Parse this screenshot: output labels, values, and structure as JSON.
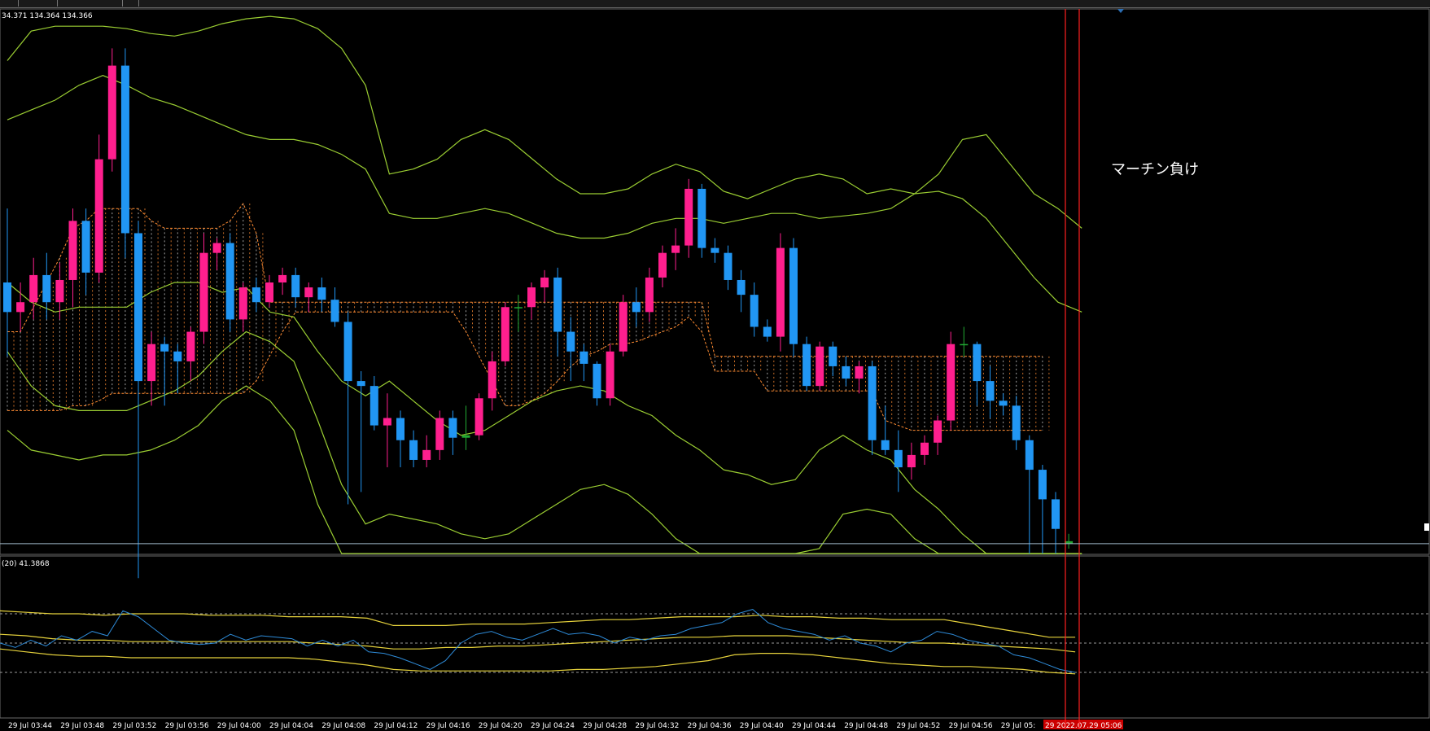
{
  "window": {
    "ohlc_readout": "34.371 134.364 134.366",
    "annotation": "マーチン負け"
  },
  "sub_window": {
    "indicator_label": "(20) 41.3868"
  },
  "colors": {
    "bull": "#ff1f8e",
    "bear": "#2196f3",
    "doji": "#22aa33",
    "band": "#9acd32",
    "cloud": "#ff8c32",
    "cloud_fill": "#d8d8d8",
    "sub_band": "#e6d23c",
    "sub_line": "#2e8bd8",
    "vline": "#ff2020",
    "grid_level": "#9a9a9a",
    "date_badge": "#cc0000"
  },
  "chart_data": {
    "type": "candlestick",
    "title": "",
    "xlabel": "",
    "ylabel": "",
    "ylim": [
      134.22,
      134.44
    ],
    "current_price_line": 134.224,
    "x_tick_labels": [
      "29 Jul 03:44",
      "29 Jul 03:48",
      "29 Jul 03:52",
      "29 Jul 03:56",
      "29 Jul 04:00",
      "29 Jul 04:04",
      "29 Jul 04:08",
      "29 Jul 04:12",
      "29 Jul 04:16",
      "29 Jul 04:20",
      "29 Jul 04:24",
      "29 Jul 04:28",
      "29 Jul 04:32",
      "29 Jul 04:36",
      "29 Jul 04:40",
      "29 Jul 04:44",
      "29 Jul 04:48",
      "29 Jul 04:52",
      "29 Jul 04:56",
      "29 Jul 05:",
      "2022.07.29 05:06"
    ],
    "date_badge_prefix": "29",
    "candles": [
      [
        134.33,
        134.36,
        134.3,
        134.318
      ],
      [
        134.318,
        134.33,
        134.31,
        134.322
      ],
      [
        134.322,
        134.34,
        134.315,
        134.333
      ],
      [
        134.333,
        134.342,
        134.315,
        134.322
      ],
      [
        134.322,
        134.338,
        134.315,
        134.331
      ],
      [
        134.331,
        134.36,
        134.32,
        134.355
      ],
      [
        134.355,
        134.36,
        134.325,
        134.334
      ],
      [
        134.334,
        134.39,
        134.33,
        134.38
      ],
      [
        134.38,
        134.425,
        134.375,
        134.418
      ],
      [
        134.418,
        134.425,
        134.34,
        134.35
      ],
      [
        134.35,
        134.355,
        134.21,
        134.29
      ],
      [
        134.29,
        134.31,
        134.28,
        134.305
      ],
      [
        134.305,
        134.308,
        134.28,
        134.302
      ],
      [
        134.302,
        134.305,
        134.285,
        134.298
      ],
      [
        134.298,
        134.312,
        134.29,
        134.31
      ],
      [
        134.31,
        134.35,
        134.305,
        134.342
      ],
      [
        134.342,
        134.348,
        134.335,
        134.346
      ],
      [
        134.346,
        134.35,
        134.31,
        134.315
      ],
      [
        134.315,
        134.33,
        134.31,
        134.328
      ],
      [
        134.328,
        134.332,
        134.318,
        134.322
      ],
      [
        134.322,
        134.333,
        134.32,
        134.33
      ],
      [
        134.33,
        134.336,
        134.325,
        134.333
      ],
      [
        134.333,
        134.336,
        134.32,
        134.324
      ],
      [
        134.324,
        134.33,
        134.318,
        134.328
      ],
      [
        134.328,
        134.332,
        134.318,
        134.323
      ],
      [
        134.323,
        134.328,
        134.312,
        134.314
      ],
      [
        134.314,
        134.318,
        134.24,
        134.29
      ],
      [
        134.29,
        134.294,
        134.245,
        134.288
      ],
      [
        134.288,
        134.292,
        134.27,
        134.272
      ],
      [
        134.272,
        134.285,
        134.255,
        134.275
      ],
      [
        134.275,
        134.278,
        134.255,
        134.266
      ],
      [
        134.266,
        134.27,
        134.255,
        134.258
      ],
      [
        134.258,
        134.268,
        134.255,
        134.262
      ],
      [
        134.262,
        134.278,
        134.258,
        134.275
      ],
      [
        134.275,
        134.278,
        134.26,
        134.267
      ],
      [
        134.267,
        134.28,
        134.262,
        134.268
      ],
      [
        134.268,
        134.285,
        134.266,
        134.283
      ],
      [
        134.283,
        134.302,
        134.278,
        134.298
      ],
      [
        134.298,
        134.322,
        134.296,
        134.32
      ],
      [
        134.32,
        134.325,
        134.31,
        134.32
      ],
      [
        134.32,
        134.33,
        134.315,
        134.328
      ],
      [
        134.328,
        134.335,
        134.322,
        134.332
      ],
      [
        134.332,
        134.336,
        134.3,
        134.31
      ],
      [
        134.31,
        134.316,
        134.29,
        134.302
      ],
      [
        134.302,
        134.305,
        134.29,
        134.297
      ],
      [
        134.297,
        134.298,
        134.28,
        134.283
      ],
      [
        134.283,
        134.305,
        134.28,
        134.302
      ],
      [
        134.302,
        134.325,
        134.3,
        134.322
      ],
      [
        134.322,
        134.328,
        134.312,
        134.318
      ],
      [
        134.318,
        134.336,
        134.314,
        134.332
      ],
      [
        134.332,
        134.345,
        134.328,
        134.342
      ],
      [
        134.342,
        134.352,
        134.335,
        134.345
      ],
      [
        134.345,
        134.372,
        134.34,
        134.368
      ],
      [
        134.368,
        134.37,
        134.34,
        134.344
      ],
      [
        134.344,
        134.348,
        134.338,
        134.342
      ],
      [
        134.342,
        134.345,
        134.327,
        134.331
      ],
      [
        134.331,
        134.335,
        134.318,
        134.325
      ],
      [
        134.325,
        134.33,
        134.308,
        134.312
      ],
      [
        134.312,
        134.315,
        134.306,
        134.308
      ],
      [
        134.308,
        134.35,
        134.302,
        134.344
      ],
      [
        134.344,
        134.348,
        134.3,
        134.305
      ],
      [
        134.305,
        134.308,
        134.286,
        134.288
      ],
      [
        134.288,
        134.306,
        134.286,
        134.304
      ],
      [
        134.304,
        134.306,
        134.292,
        134.296
      ],
      [
        134.296,
        134.3,
        134.288,
        134.291
      ],
      [
        134.291,
        134.298,
        134.285,
        134.296
      ],
      [
        134.296,
        134.298,
        134.26,
        134.266
      ],
      [
        134.266,
        134.28,
        134.26,
        134.262
      ],
      [
        134.262,
        134.27,
        134.245,
        134.255
      ],
      [
        134.255,
        134.265,
        134.25,
        134.26
      ],
      [
        134.26,
        134.268,
        134.256,
        134.265
      ],
      [
        134.265,
        134.276,
        134.26,
        134.274
      ],
      [
        134.274,
        134.31,
        134.27,
        134.305
      ],
      [
        134.305,
        134.312,
        134.3,
        134.305
      ],
      [
        134.305,
        134.306,
        134.28,
        134.29
      ],
      [
        134.29,
        134.296,
        134.275,
        134.282
      ],
      [
        134.282,
        134.285,
        134.276,
        134.28
      ],
      [
        134.28,
        134.284,
        134.262,
        134.266
      ],
      [
        134.266,
        134.268,
        134.22,
        134.254
      ],
      [
        134.254,
        134.256,
        134.22,
        134.242
      ],
      [
        134.242,
        134.245,
        134.22,
        134.23
      ],
      [
        134.225,
        134.228,
        134.222,
        134.224
      ]
    ],
    "bollinger": {
      "outer_upper": [
        134.42,
        134.432,
        134.434,
        134.434,
        134.434,
        134.433,
        134.431,
        134.43,
        134.432,
        134.435,
        134.437,
        134.438,
        134.437,
        134.433,
        134.425,
        134.41,
        134.374,
        134.376,
        134.38,
        134.388,
        134.392,
        134.388,
        134.38,
        134.372,
        134.366,
        134.366,
        134.368,
        134.374,
        134.378,
        134.375,
        134.367,
        134.364,
        134.368,
        134.372,
        134.374,
        134.372,
        134.366,
        134.368,
        134.366,
        134.374,
        134.388,
        134.39,
        134.378,
        134.366,
        134.36,
        134.352
      ],
      "mid_upper": [
        134.396,
        134.4,
        134.404,
        134.41,
        134.414,
        134.41,
        134.405,
        134.402,
        134.398,
        134.394,
        134.39,
        134.388,
        134.388,
        134.386,
        134.382,
        134.376,
        134.358,
        134.356,
        134.356,
        134.358,
        134.36,
        134.358,
        134.354,
        134.35,
        134.348,
        134.348,
        134.35,
        134.354,
        134.356,
        134.356,
        134.354,
        134.356,
        134.358,
        134.358,
        134.356,
        134.357,
        134.358,
        134.36,
        134.366,
        134.367,
        134.364,
        134.356,
        134.344,
        134.332,
        134.322,
        134.318
      ],
      "middle": [
        134.33,
        134.322,
        134.318,
        134.32,
        134.32,
        134.32,
        134.326,
        134.33,
        134.33,
        134.326,
        134.328,
        134.318,
        134.316,
        134.302,
        134.29,
        134.284,
        134.29,
        134.282,
        134.274,
        134.268,
        134.27,
        134.276,
        134.282,
        134.286,
        134.288,
        134.286,
        134.28,
        134.276,
        134.268,
        134.262,
        134.254,
        134.252,
        134.248,
        134.25,
        134.262,
        134.268,
        134.262,
        134.258,
        134.246,
        134.238,
        134.228,
        134.218,
        134.208,
        134.2,
        134.194
      ],
      "mid_lower": [
        134.302,
        134.288,
        134.28,
        134.278,
        134.278,
        134.278,
        134.282,
        134.286,
        134.292,
        134.302,
        134.31,
        134.306,
        134.298,
        134.274,
        134.248,
        134.232,
        134.236,
        134.234,
        134.232,
        134.228,
        134.226,
        134.228,
        134.234,
        134.24,
        134.246,
        134.248,
        134.244,
        134.236,
        134.226,
        134.218,
        134.21,
        134.206,
        134.204,
        134.208,
        134.222,
        134.236,
        134.238,
        134.236,
        134.226,
        134.214,
        134.2,
        134.188,
        134.176,
        134.166,
        134.158,
        134.152
      ],
      "outer_lower": [
        134.27,
        134.262,
        134.26,
        134.258,
        134.26,
        134.26,
        134.262,
        134.266,
        134.272,
        134.282,
        134.288,
        134.282,
        134.27,
        134.24,
        134.212,
        134.196,
        134.2,
        134.2,
        134.198,
        134.194,
        134.192,
        134.194,
        134.198,
        134.204,
        134.212,
        134.218,
        134.214,
        134.204,
        134.192,
        134.182,
        134.174,
        134.168,
        134.166,
        134.172,
        134.188,
        134.208,
        134.212,
        134.212,
        134.202,
        134.19,
        134.176,
        134.164,
        134.152,
        134.142,
        134.136,
        134.13
      ]
    },
    "cloud": {
      "top": [
        134.31,
        134.31,
        134.32,
        134.33,
        134.34,
        134.352,
        134.355,
        134.36,
        134.36,
        134.36,
        134.36,
        134.355,
        134.352,
        134.352,
        134.352,
        134.352,
        134.352,
        134.355,
        134.362,
        134.35,
        134.322,
        134.322,
        134.322,
        134.322,
        134.322,
        134.322,
        134.322,
        134.322,
        134.322,
        134.322,
        134.322,
        134.322,
        134.322,
        134.322,
        134.322,
        134.322,
        134.322,
        134.322,
        134.322,
        134.322,
        134.322,
        134.322,
        134.322,
        134.322,
        134.322,
        134.322,
        134.322,
        134.322,
        134.322,
        134.322,
        134.322,
        134.322,
        134.322,
        134.322,
        134.3,
        134.3,
        134.3,
        134.3,
        134.3,
        134.3,
        134.3,
        134.3,
        134.3,
        134.3,
        134.3,
        134.3,
        134.3,
        134.3,
        134.3,
        134.3,
        134.3,
        134.3,
        134.3,
        134.3,
        134.3,
        134.3,
        134.3,
        134.3,
        134.3,
        134.3
      ],
      "bottom": [
        134.278,
        134.278,
        134.278,
        134.278,
        134.278,
        134.28,
        134.28,
        134.282,
        134.285,
        134.285,
        134.285,
        134.285,
        134.285,
        134.285,
        134.285,
        134.285,
        134.285,
        134.285,
        134.285,
        134.29,
        134.3,
        134.31,
        134.318,
        134.318,
        134.318,
        134.318,
        134.318,
        134.318,
        134.318,
        134.318,
        134.318,
        134.318,
        134.318,
        134.318,
        134.318,
        134.31,
        134.3,
        134.29,
        134.28,
        134.28,
        134.282,
        134.285,
        134.29,
        134.296,
        134.3,
        134.302,
        134.305,
        134.305,
        134.306,
        134.308,
        134.31,
        134.312,
        134.316,
        134.31,
        134.294,
        134.294,
        134.294,
        134.294,
        134.286,
        134.286,
        134.286,
        134.286,
        134.286,
        134.286,
        134.286,
        134.286,
        134.286,
        134.274,
        134.272,
        134.27,
        134.27,
        134.27,
        134.27,
        134.27,
        134.27,
        134.27,
        134.27,
        134.27,
        134.27,
        134.27
      ]
    },
    "sub_indicator": {
      "ylim": [
        0,
        100
      ],
      "levels": [
        70,
        50,
        30
      ],
      "upper": [
        72,
        71,
        70,
        70,
        69,
        70,
        70,
        70,
        69,
        69,
        69,
        68,
        68,
        68,
        67,
        62,
        62,
        62,
        63,
        63,
        63,
        64,
        65,
        66,
        66,
        67,
        68,
        68,
        68,
        69,
        68,
        68,
        67,
        67,
        66,
        66,
        66,
        63,
        60,
        57,
        54,
        54
      ],
      "middle": [
        56,
        55,
        53,
        52,
        52,
        51,
        51,
        51,
        51,
        51,
        51,
        51,
        50,
        49,
        48,
        46,
        46,
        47,
        47,
        48,
        48,
        49,
        50,
        51,
        52,
        53,
        54,
        54,
        55,
        55,
        55,
        54,
        53,
        52,
        51,
        50,
        50,
        49,
        48,
        47,
        46,
        44
      ],
      "lower": [
        46,
        44,
        42,
        41,
        41,
        40,
        40,
        40,
        40,
        40,
        40,
        40,
        39,
        37,
        35,
        32,
        31,
        31,
        31,
        31,
        31,
        31,
        32,
        32,
        33,
        34,
        36,
        38,
        42,
        43,
        43,
        42,
        40,
        38,
        36,
        35,
        34,
        34,
        33,
        32,
        30,
        29
      ],
      "line": [
        50,
        47,
        52,
        48,
        55,
        52,
        58,
        55,
        72,
        68,
        60,
        52,
        50,
        49,
        50,
        56,
        52,
        55,
        54,
        53,
        48,
        52,
        48,
        52,
        44,
        43,
        40,
        36,
        32,
        38,
        50,
        56,
        58,
        54,
        52,
        56,
        60,
        56,
        57,
        55,
        50,
        54,
        52,
        55,
        56,
        60,
        62,
        64,
        70,
        73,
        64,
        60,
        58,
        56,
        52,
        55,
        50,
        48,
        44,
        50,
        52,
        58,
        56,
        52,
        50,
        48,
        42,
        40,
        36,
        32,
        30
      ]
    },
    "vertical_lines_at_index": [
      82,
      83
    ]
  }
}
